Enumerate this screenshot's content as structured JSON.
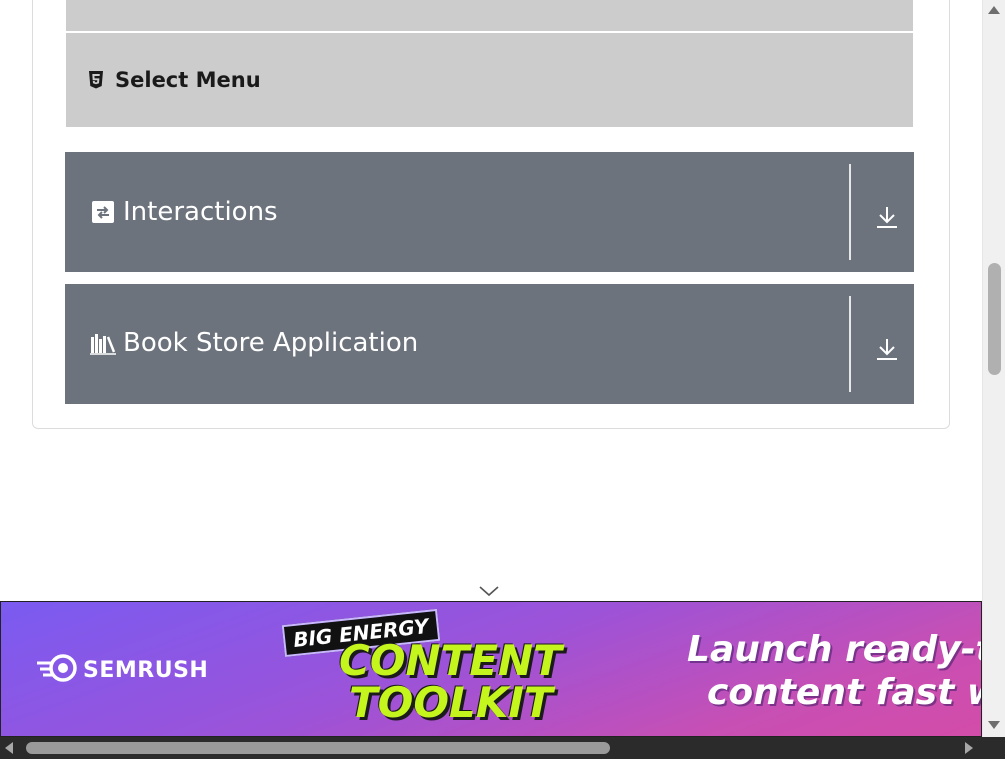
{
  "menu": {
    "select_menu_label": "Select Menu",
    "select_menu_icon": "html5-icon"
  },
  "groups": [
    {
      "title": "Interactions",
      "icon": "exchange-icon",
      "action_icon": "download-icon"
    },
    {
      "title": "Book Store Application",
      "icon": "books-icon",
      "action_icon": "download-icon"
    }
  ],
  "ad": {
    "brand": "SEMRUSH",
    "tag": "BIG ENERGY",
    "headline_line1": "CONTENT",
    "headline_line2": "TOOLKIT",
    "copy_line1": "Launch ready-to",
    "copy_line2": "content fast wi",
    "colors": {
      "gradient_start": "#7a5bf1",
      "gradient_end": "#d34ca9",
      "headline": "#c4f51c"
    }
  },
  "colors": {
    "group_background": "#6c737d",
    "menu_background": "#cccccc"
  }
}
